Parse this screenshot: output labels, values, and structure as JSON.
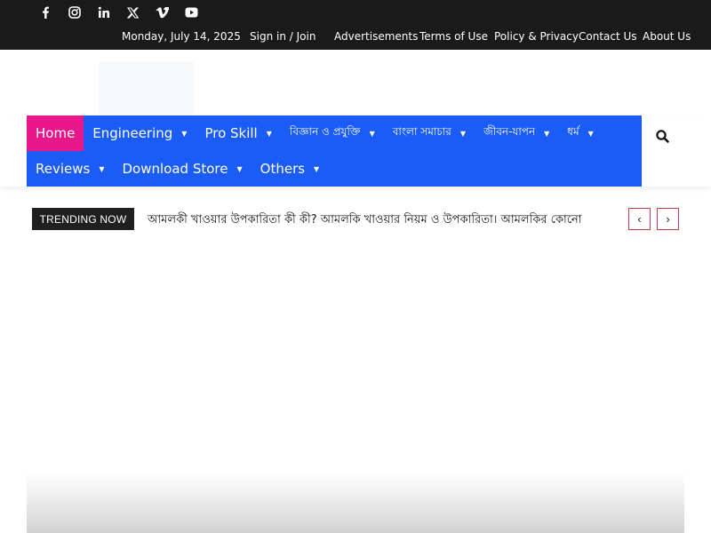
{
  "topbar": {
    "social_icons": [
      "facebook-icon",
      "instagram-icon",
      "linkedin-icon",
      "x-twitter-icon",
      "vimeo-icon",
      "youtube-icon"
    ],
    "date": "Monday, July 14, 2025",
    "sign_in": "Sign in / Join",
    "links": [
      "Advertisements",
      "Terms of Use",
      "Policy & Privacy",
      "Contact Us",
      "About Us"
    ]
  },
  "nav": {
    "row1": [
      {
        "label": "Home",
        "active": true,
        "caret": false
      },
      {
        "label": "Engineering",
        "caret": true
      },
      {
        "label": "Pro Skill",
        "caret": true
      },
      {
        "label": "বিজ্ঞান ও প্রযুক্তি",
        "caret": true
      },
      {
        "label": "বাংলা সমাচার",
        "caret": true
      },
      {
        "label": "জীবন-যাপন",
        "caret": true
      },
      {
        "label": "ধর্ম",
        "caret": true
      }
    ],
    "row2": [
      {
        "label": "Reviews",
        "caret": true
      },
      {
        "label": "Download Store",
        "caret": true
      },
      {
        "label": "Others",
        "caret": true
      }
    ],
    "search_icon": "search-icon"
  },
  "trending": {
    "label": "TRENDING NOW",
    "headline": "আমলকী খাওয়ার উপকারিতা কী কী? আমলকি খাওয়ার নিয়ম ও উপকারিতা। আমলকির কোনো",
    "prev": "‹",
    "next": "›"
  },
  "colors": {
    "topbar_bg": "#1a1a1a",
    "nav_bg": "#1a5cf5",
    "active_bg": "#e8178a",
    "trending_btn_border": "#d03b4a"
  }
}
